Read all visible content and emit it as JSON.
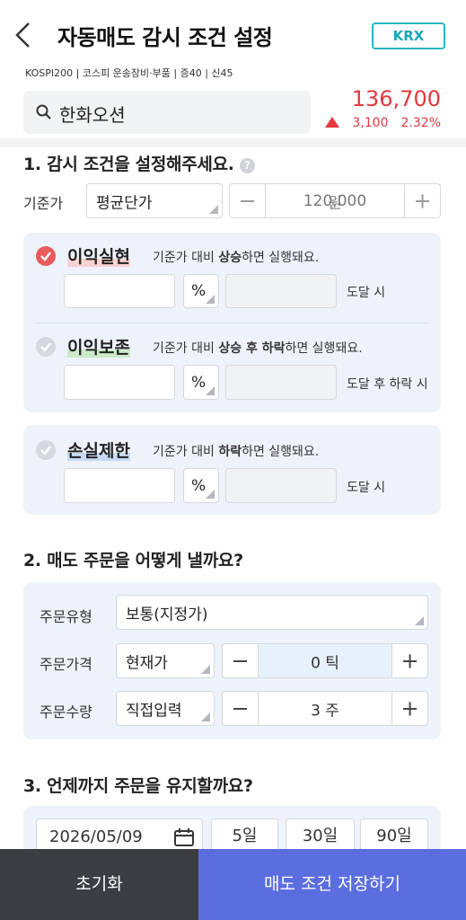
{
  "header": {
    "title": "자동매도 감시 조건 설정",
    "market_badge": "KRX"
  },
  "stock": {
    "tags": "KOSPI200 | 코스피 운송장비·부품 | 증40 | 신45",
    "name": "한화오션",
    "price": "136,700",
    "change": "3,100",
    "change_pct": "2.32%",
    "up_color": "#e2383f"
  },
  "section1": {
    "title": "1. 감시 조건을 설정해주세요.",
    "help_icon": "?",
    "base_label": "기준가",
    "base_type": "평균단가",
    "base_price": "120,000",
    "base_unit": "원",
    "minus": "−",
    "plus": "+",
    "conditions": [
      {
        "name": "이익실현",
        "desc_pre": "기준가 대비 ",
        "desc_bold": "상승",
        "desc_post": "하면 실행돼요.",
        "unit": "%",
        "reach": "도달 시",
        "checked": true
      },
      {
        "name": "이익보존",
        "desc_pre": "기준가 대비 ",
        "desc_bold": "상승 후 하락",
        "desc_post": "하면 실행돼요.",
        "unit": "%",
        "reach": "도달 후 하락 시",
        "checked": false
      },
      {
        "name": "손실제한",
        "desc_pre": "기준가 대비 ",
        "desc_bold": "하락",
        "desc_post": "하면 실행돼요.",
        "unit": "%",
        "reach": "도달 시",
        "checked": false
      }
    ]
  },
  "section2": {
    "title": "2. 매도 주문을 어떻게 낼까요?",
    "order_type_label": "주문유형",
    "order_type": "보통(지정가)",
    "order_price_label": "주문가격",
    "order_price_type": "현재가",
    "order_price_value": "0 틱",
    "order_qty_label": "주문수량",
    "order_qty_type": "직접입력",
    "order_qty_value": "3 주",
    "minus": "−",
    "plus": "+"
  },
  "section3": {
    "title": "3. 언제까지 주문을 유지할까요?",
    "date": "2026/05/09",
    "chips": [
      "5일",
      "30일",
      "90일"
    ]
  },
  "footer": {
    "reset": "초기화",
    "save": "매도 조건 저장하기"
  }
}
